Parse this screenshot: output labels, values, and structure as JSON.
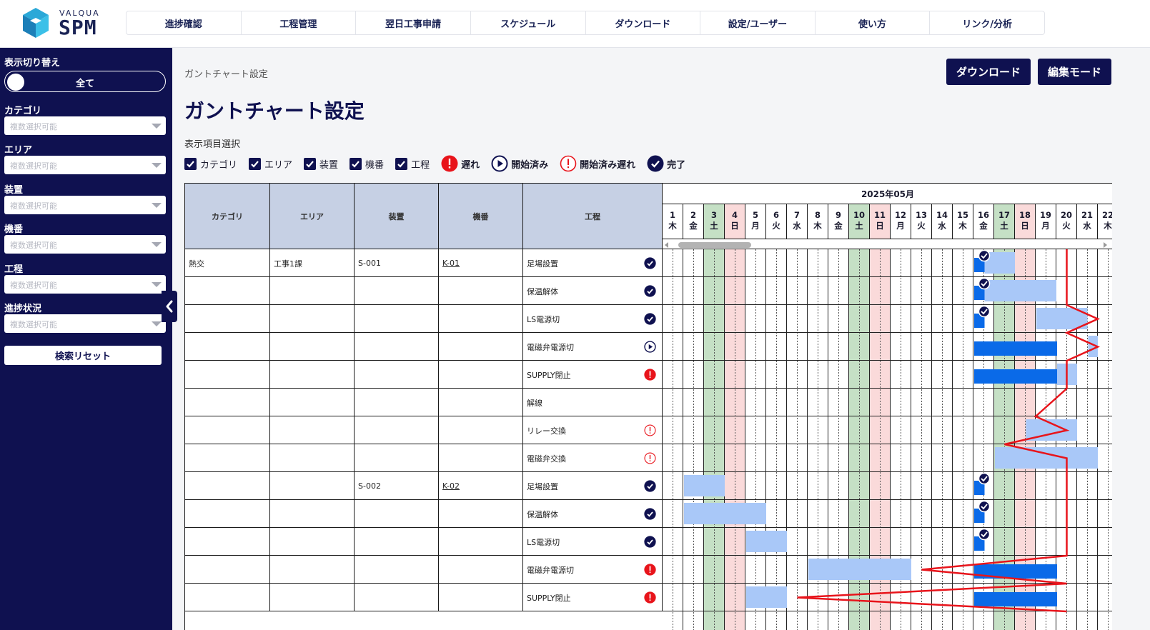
{
  "logo": {
    "small": "VALQUA",
    "big": "SPM"
  },
  "nav": [
    "進捗確認",
    "工程管理",
    "翌日工事申請",
    "スケジュール",
    "ダウンロード",
    "設定/ユーザー",
    "使い方",
    "リンク/分析"
  ],
  "sidebar": {
    "toggle_label": "表示切り替え",
    "toggle_value": "全て",
    "filters": [
      {
        "label": "カテゴリ",
        "placeholder": "複数選択可能"
      },
      {
        "label": "エリア",
        "placeholder": "複数選択可能"
      },
      {
        "label": "装置",
        "placeholder": "複数選択可能"
      },
      {
        "label": "機番",
        "placeholder": "複数選択可能"
      },
      {
        "label": "工程",
        "placeholder": "複数選択可能"
      },
      {
        "label": "進捗状況",
        "placeholder": "複数選択可能"
      }
    ],
    "reset_label": "検索リセット"
  },
  "main": {
    "breadcrumb": "ガントチャート設定",
    "title": "ガントチャート設定",
    "download_label": "ダウンロード",
    "edit_label": "編集モード",
    "selection_title": "表示項目選択",
    "checkboxes": [
      "カテゴリ",
      "エリア",
      "装置",
      "機番",
      "工程"
    ],
    "legend": {
      "late": "遅れ",
      "started": "開始済み",
      "started_late": "開始済み遅れ",
      "done": "完了"
    }
  },
  "table": {
    "headers": [
      "カテゴリ",
      "エリア",
      "装置",
      "機番",
      "工程"
    ],
    "month": "2025年05月",
    "days": [
      {
        "d": "1",
        "w": "木"
      },
      {
        "d": "2",
        "w": "金"
      },
      {
        "d": "3",
        "w": "土"
      },
      {
        "d": "4",
        "w": "日"
      },
      {
        "d": "5",
        "w": "月"
      },
      {
        "d": "6",
        "w": "火"
      },
      {
        "d": "7",
        "w": "水"
      },
      {
        "d": "8",
        "w": "木"
      },
      {
        "d": "9",
        "w": "金"
      },
      {
        "d": "10",
        "w": "土"
      },
      {
        "d": "11",
        "w": "日"
      },
      {
        "d": "12",
        "w": "月"
      },
      {
        "d": "13",
        "w": "火"
      },
      {
        "d": "14",
        "w": "水"
      },
      {
        "d": "15",
        "w": "木"
      },
      {
        "d": "16",
        "w": "金"
      },
      {
        "d": "17",
        "w": "土"
      },
      {
        "d": "18",
        "w": "日"
      },
      {
        "d": "19",
        "w": "月"
      },
      {
        "d": "20",
        "w": "火"
      },
      {
        "d": "21",
        "w": "水"
      },
      {
        "d": "22",
        "w": "木"
      }
    ],
    "rows": [
      {
        "category": "熱交",
        "area": "工事1課",
        "device": "S-001",
        "machine": "K-01",
        "process": "足場設置",
        "status": "done"
      },
      {
        "category": "",
        "area": "",
        "device": "",
        "machine": "",
        "process": "保温解体",
        "status": "done"
      },
      {
        "category": "",
        "area": "",
        "device": "",
        "machine": "",
        "process": "LS電源切",
        "status": "done"
      },
      {
        "category": "",
        "area": "",
        "device": "",
        "machine": "",
        "process": "電磁弁電源切",
        "status": "started"
      },
      {
        "category": "",
        "area": "",
        "device": "",
        "machine": "",
        "process": "SUPPLY閉止",
        "status": "late"
      },
      {
        "category": "",
        "area": "",
        "device": "",
        "machine": "",
        "process": "解線",
        "status": ""
      },
      {
        "category": "",
        "area": "",
        "device": "",
        "machine": "",
        "process": "リレー交換",
        "status": "started_late"
      },
      {
        "category": "",
        "area": "",
        "device": "",
        "machine": "",
        "process": "電磁弁交換",
        "status": "started_late"
      },
      {
        "category": "",
        "area": "",
        "device": "S-002",
        "machine": "K-02",
        "process": "足場設置",
        "status": "done"
      },
      {
        "category": "",
        "area": "",
        "device": "",
        "machine": "",
        "process": "保温解体",
        "status": "done"
      },
      {
        "category": "",
        "area": "",
        "device": "",
        "machine": "",
        "process": "LS電源切",
        "status": "done"
      },
      {
        "category": "",
        "area": "",
        "device": "",
        "machine": "",
        "process": "電磁弁電源切",
        "status": "late"
      },
      {
        "category": "",
        "area": "",
        "device": "",
        "machine": "",
        "process": "SUPPLY閉止",
        "status": "late"
      }
    ],
    "plan_bars": [
      {
        "row": 0,
        "start": 16.5,
        "end": 18
      },
      {
        "row": 1,
        "start": 16.5,
        "end": 20
      },
      {
        "row": 2,
        "start": 19,
        "end": 21.5
      },
      {
        "row": 3,
        "start": 21.5,
        "end": 22
      },
      {
        "row": 4,
        "start": 20,
        "end": 21
      },
      {
        "row": 6,
        "start": 18.5,
        "end": 21
      },
      {
        "row": 7,
        "start": 17,
        "end": 22
      },
      {
        "row": 8,
        "start": 2,
        "end": 4
      },
      {
        "row": 9,
        "start": 2,
        "end": 6
      },
      {
        "row": 10,
        "start": 5,
        "end": 7
      },
      {
        "row": 11,
        "start": 8,
        "end": 13
      },
      {
        "row": 12,
        "start": 5,
        "end": 7
      }
    ],
    "actual_bars": [
      {
        "row": 0,
        "start": 16,
        "end": 16.5
      },
      {
        "row": 1,
        "start": 16,
        "end": 16.5
      },
      {
        "row": 2,
        "start": 16,
        "end": 16.5
      },
      {
        "row": 3,
        "start": 16,
        "end": 20
      },
      {
        "row": 4,
        "start": 16,
        "end": 20
      },
      {
        "row": 8,
        "start": 16,
        "end": 16.5
      },
      {
        "row": 9,
        "start": 16,
        "end": 16.5
      },
      {
        "row": 10,
        "start": 16,
        "end": 16.5
      },
      {
        "row": 11,
        "start": 16,
        "end": 20
      },
      {
        "row": 12,
        "start": 16,
        "end": 20
      }
    ],
    "done_marks": [
      0,
      1,
      2,
      8,
      9,
      10
    ],
    "today_day": 20,
    "progress_line": [
      {
        "row": 0,
        "day": 20
      },
      {
        "row": 1,
        "day": 20
      },
      {
        "row": 2,
        "day": 20
      },
      {
        "row": 2.5,
        "day": 21.5
      },
      {
        "row": 3,
        "day": 20
      },
      {
        "row": 3.5,
        "day": 21.5
      },
      {
        "row": 4,
        "day": 20
      },
      {
        "row": 5,
        "day": 20
      },
      {
        "row": 6,
        "day": 18.5
      },
      {
        "row": 6.5,
        "day": 20
      },
      {
        "row": 7,
        "day": 17
      },
      {
        "row": 7.5,
        "day": 20
      },
      {
        "row": 8,
        "day": 20
      },
      {
        "row": 9,
        "day": 20
      },
      {
        "row": 10,
        "day": 20
      },
      {
        "row": 11,
        "day": 20
      },
      {
        "row": 11.5,
        "day": 13
      },
      {
        "row": 12,
        "day": 20
      },
      {
        "row": 12.5,
        "day": 7
      },
      {
        "row": 13,
        "day": 20
      }
    ]
  }
}
